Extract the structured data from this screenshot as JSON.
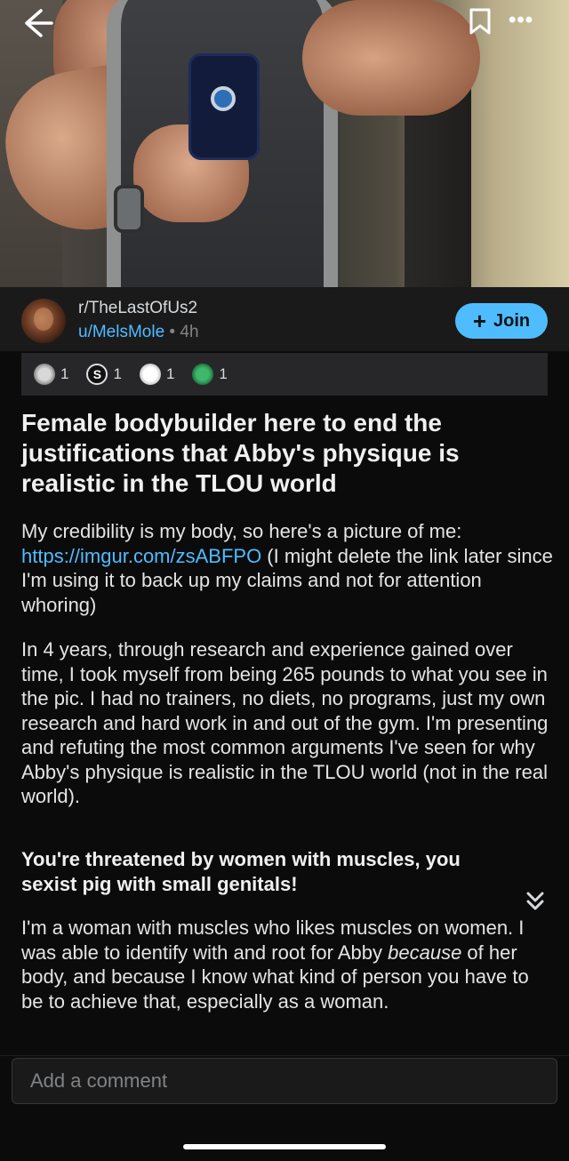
{
  "nav": {
    "back_icon": "arrow-left-icon",
    "save_icon": "bookmark-icon",
    "more_icon": "more-horizontal-icon",
    "more_label": "•••"
  },
  "post": {
    "subreddit": "r/TheLastOfUs2",
    "author": "u/MelsMole",
    "separator": " • ",
    "age": "4h",
    "join_label": "Join",
    "join_plus": "+"
  },
  "awards": [
    {
      "icon": "award-silver-icon",
      "count": "1"
    },
    {
      "icon": "award-s-icon",
      "glyph": "S",
      "count": "1"
    },
    {
      "icon": "award-face-icon",
      "count": "1"
    },
    {
      "icon": "award-green-icon",
      "count": "1"
    }
  ],
  "content": {
    "title": "Female bodybuilder here to end the justifications that Abby's physique is realistic in the TLOU world",
    "p1_before": "My credibility is my body, so here's a picture of me: ",
    "p1_link": "https://imgur.com/zsABFPO",
    "p1_after": "  (I might delete the link later since I'm using it to back up my claims and not for attention whoring)",
    "p2": "In 4 years, through research and experience gained over time, I took myself from being 265 pounds to what you see in the pic. I had no trainers, no diets, no programs, just my own research and hard work in and out of the gym. I'm presenting and refuting the most common arguments I've seen for why Abby's physique is realistic in the TLOU world (not in the real world).",
    "heading": "You're threatened by women with muscles, you sexist pig with small genitals!",
    "p3_before": "I'm a woman with muscles who likes muscles on women. I was able to identify with and root for Abby ",
    "p3_em": "because",
    "p3_after": " of her body, and because I know what kind of person you have to be to achieve that, especially as a woman.",
    "collapse_icon": "chevron-double-down-icon"
  },
  "comment": {
    "placeholder": "Add a comment"
  },
  "colors": {
    "accent": "#4fbcff",
    "background": "#0b0b0c",
    "card": "#1a1a1b"
  }
}
